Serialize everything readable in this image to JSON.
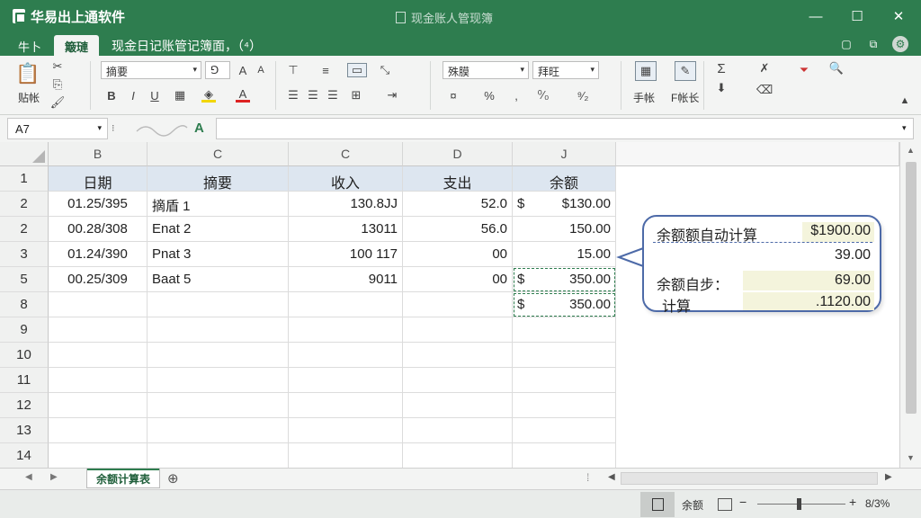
{
  "titlebar": {
    "app_name": "华易出上通软件",
    "doc_title": "现金账人管现簿",
    "minimize": "—",
    "maximize": "☐",
    "close": "✕"
  },
  "tabs": [
    {
      "label": "牛卜",
      "active": false
    },
    {
      "label": "簸璉",
      "active": true
    }
  ],
  "doc_name": "现金日记账管记簿面，（⁴）",
  "ribbon": {
    "font_name": "摘要",
    "font_size": "⅁",
    "bold": "B",
    "italic": "I",
    "underline": "U",
    "paste_label": "贴帐",
    "num_format": "殊膜",
    "style_box": "拜旺",
    "percent": "%",
    "comma": "⁹⁄₂",
    "insert_label": "手帐",
    "format_label": "F帐长",
    "sum": "Σ"
  },
  "formula_bar": {
    "name_box": "A7",
    "fx": "A"
  },
  "columns": [
    "B",
    "C",
    "C",
    "D",
    "J"
  ],
  "rows": [
    {
      "num": "1",
      "cells": [
        "日期",
        "摘要",
        "收入",
        "支出",
        "余额"
      ],
      "header": true
    },
    {
      "num": "2",
      "cells": [
        "01.25/395",
        "摘盾 1",
        "130.8JJ",
        "52.0",
        "$130.00"
      ],
      "currency": "$"
    },
    {
      "num": "2",
      "cells": [
        "00.28/308",
        "Enat 2",
        "13011",
        "56.0",
        "150.00"
      ]
    },
    {
      "num": "3",
      "cells": [
        "01.24/390",
        "Pnat 3",
        "100 117",
        "00",
        "15.00"
      ]
    },
    {
      "num": "5",
      "cells": [
        "00.25/309",
        "Baat 5",
        "9011",
        "00",
        "350.00"
      ],
      "currency": "$"
    },
    {
      "num": "8",
      "cells": [
        "",
        "",
        "",
        "",
        "350.00"
      ],
      "currency": "$"
    },
    {
      "num": "9",
      "cells": [
        "",
        "",
        "",
        "",
        ""
      ]
    },
    {
      "num": "10",
      "cells": [
        "",
        "",
        "",
        "",
        ""
      ]
    },
    {
      "num": "11",
      "cells": [
        "",
        "",
        "",
        "",
        ""
      ]
    },
    {
      "num": "12",
      "cells": [
        "",
        "",
        "",
        "",
        ""
      ]
    },
    {
      "num": "13",
      "cells": [
        "",
        "",
        "",
        "",
        ""
      ]
    },
    {
      "num": "14",
      "cells": [
        "",
        "",
        "",
        "",
        ""
      ]
    }
  ],
  "callout": {
    "title": "余额额自动计算",
    "title_value": "$1900.00",
    "value2": "39.00",
    "label3": "余额自步：",
    "value3": "69.00",
    "label4": "计算",
    "value4": ".1120.00"
  },
  "sheet": {
    "tab_label": "余额计算表"
  },
  "status": {
    "mode_label": "余额",
    "zoom": "8/3%"
  },
  "colors": {
    "accent": "#2e7d4f",
    "header_fill": "#dde6f0",
    "callout_border": "#4d6aa8"
  }
}
